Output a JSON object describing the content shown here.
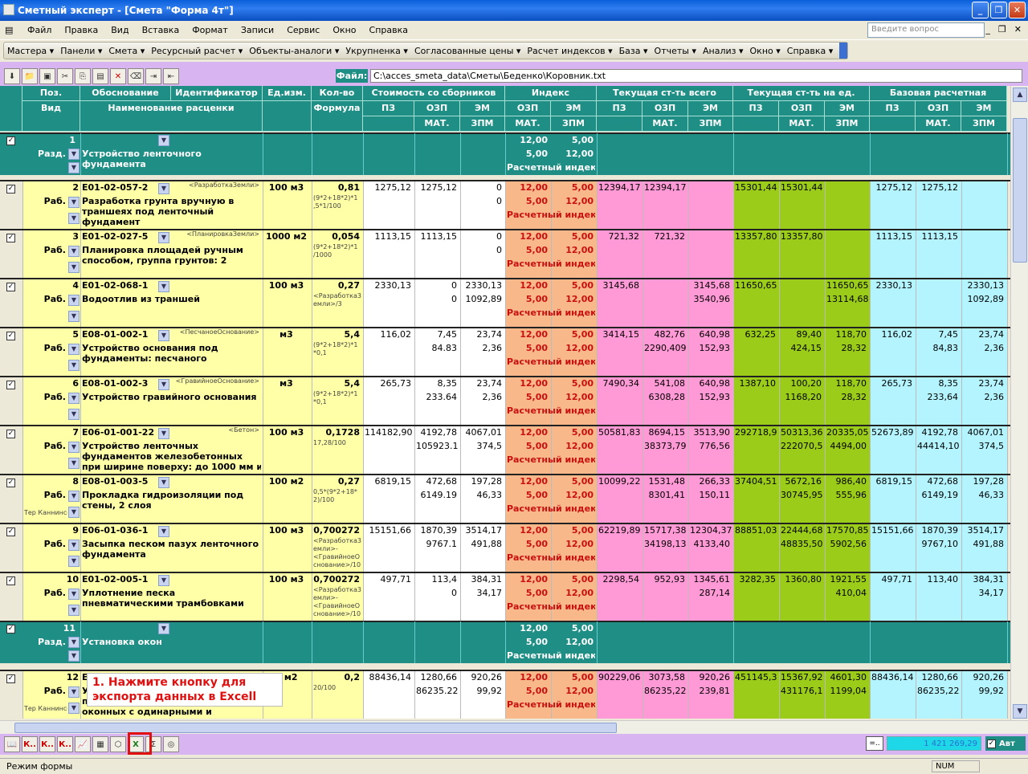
{
  "window": {
    "title": "Сметный эксперт - [Смета \"Форма 4т\"]"
  },
  "menu": [
    "Файл",
    "Правка",
    "Вид",
    "Вставка",
    "Формат",
    "Записи",
    "Сервис",
    "Окно",
    "Справка"
  ],
  "ask_placeholder": "Введите вопрос",
  "toolbar2": [
    "Мастера ▾",
    "Панели ▾",
    "Смета ▾",
    "Ресурсный расчет ▾",
    "Объекты-аналоги ▾",
    "Укрупненка ▾",
    "Согласованные цены ▾",
    "Расчет индексов ▾",
    "База ▾",
    "Отчеты ▾",
    "Анализ ▾",
    "Окно ▾",
    "Справка ▾"
  ],
  "file": {
    "label": "Файл:",
    "path": "C:\\acces_smeta_data\\Сметы\\Беденко\\Коровник.txt"
  },
  "headers": {
    "r1": [
      "Поз.",
      "Обоснование",
      "Идентификатор",
      "Ед.изм.",
      "Кол-во",
      "Стоимость со сборников",
      "Индекс",
      "Текущая ст-ть всего",
      "Текущая ст-ть на ед.",
      "Базовая расчетная"
    ],
    "vid": "Вид",
    "naim": "Наименование расценки",
    "formula": "Формула",
    "sub1": [
      "ПЗ",
      "ОЗП",
      "ЭМ",
      "ОЗП",
      "ЭМ",
      "ПЗ",
      "ОЗП",
      "ЭМ",
      "ПЗ",
      "ОЗП",
      "ЭМ",
      "ПЗ",
      "ОЗП",
      "ЭМ"
    ],
    "sub2": [
      "МАТ.",
      "ЗПМ",
      "МАТ.",
      "ЗПМ",
      "МАТ.",
      "ЗПМ",
      "МАТ.",
      "ЗПМ",
      "МАТ.",
      "ЗПМ"
    ]
  },
  "sections": [
    {
      "num": "1",
      "vid": "Разд.",
      "name1": "Устройство ленточного",
      "name2": "фундамента",
      "i1": "12,00",
      "i2": "5,00",
      "i3": "5,00",
      "i4": "12,00",
      "i5": "Расчетный индекс"
    },
    {
      "num": "11",
      "vid": "Разд.",
      "name1": "Установка окон",
      "name2": "",
      "i1": "12,00",
      "i2": "5,00",
      "i3": "5,00",
      "i4": "12,00",
      "i5": "Расчетный индекс"
    }
  ],
  "rows": [
    {
      "num": "2",
      "code": "Е01-02-057-2",
      "tag": "<РазработкаЗемли>",
      "unit": "100 м3",
      "qty": "0,81",
      "f1": "(9*2+18*2)*1",
      "f2": ",5*1/100",
      "f3": "",
      "vid": "Раб.",
      "n1": "Разработка грунта вручную в",
      "n2": "траншеях под ленточный",
      "n3": "фундамент",
      "pz": "1275,12",
      "ozp": "1275,12",
      "em": "0",
      "mat": "",
      "zpm": "0",
      "cpz": "12394,17",
      "cozp": "12394,17",
      "cem": "",
      "cmat": "",
      "czpm": "",
      "upz": "15301,44",
      "uozp": "15301,44",
      "uem": "",
      "umat": "",
      "uzpm": "",
      "bpz": "1275,12",
      "bozp": "1275,12",
      "bem": "",
      "bmat": "",
      "bzpm": "",
      "extra": ""
    },
    {
      "num": "3",
      "code": "Е01-02-027-5",
      "tag": "<ПланировкаЗемли>",
      "unit": "1000 м2",
      "qty": "0,054",
      "f1": "(9*2+18*2)*1",
      "f2": "/1000",
      "f3": "",
      "vid": "Раб.",
      "n1": "Планировка площадей ручным",
      "n2": "способом, группа грунтов: 2",
      "n3": "",
      "pz": "1113,15",
      "ozp": "1113,15",
      "em": "0",
      "mat": "",
      "zpm": "0",
      "cpz": "721,32",
      "cozp": "721,32",
      "cem": "",
      "cmat": "",
      "czpm": "",
      "upz": "13357,80",
      "uozp": "13357,80",
      "uem": "",
      "umat": "",
      "uzpm": "",
      "bpz": "1113,15",
      "bozp": "1113,15",
      "bem": "",
      "bmat": "",
      "bzpm": "",
      "extra": ""
    },
    {
      "num": "4",
      "code": "Е01-02-068-1",
      "tag": "",
      "unit": "100 м3",
      "qty": "0,27",
      "f1": "<Разработка3",
      "f2": "емли>/3",
      "f3": "",
      "vid": "Раб.",
      "n1": "Водоотлив из траншей",
      "n2": "",
      "n3": "",
      "pz": "2330,13",
      "ozp": "0",
      "em": "2330,13",
      "mat": "0",
      "zpm": "1092,89",
      "cpz": "3145,68",
      "cozp": "",
      "cem": "3145,68",
      "cmat": "",
      "czpm": "3540,96",
      "upz": "11650,65",
      "uozp": "",
      "uem": "11650,65",
      "umat": "",
      "uzpm": "13114,68",
      "bpz": "2330,13",
      "bozp": "",
      "bem": "2330,13",
      "bmat": "",
      "bzpm": "1092,89",
      "extra": ""
    },
    {
      "num": "5",
      "code": "Е08-01-002-1",
      "tag": "<ПесчаноеОснование>",
      "unit": "м3",
      "qty": "5,4",
      "f1": "(9*2+18*2)*1",
      "f2": "*0,1",
      "f3": "",
      "vid": "Раб.",
      "n1": "Устройство основания под",
      "n2": "фундаменты: песчаного",
      "n3": "",
      "pz": "116,02",
      "ozp": "7,45",
      "em": "23,74",
      "mat": "84.83",
      "zpm": "2,36",
      "cpz": "3414,15",
      "cozp": "482,76",
      "cem": "640,98",
      "cmat": "2290,4099",
      "czpm": "152,93",
      "upz": "632,25",
      "uozp": "89,40",
      "uem": "118,70",
      "umat": "424,15",
      "uzpm": "28,32",
      "bpz": "116,02",
      "bozp": "7,45",
      "bem": "23,74",
      "bmat": "84,83",
      "bzpm": "2,36",
      "extra": ""
    },
    {
      "num": "6",
      "code": "Е08-01-002-3",
      "tag": "<ГравийноеОснование>",
      "unit": "м3",
      "qty": "5,4",
      "f1": "(9*2+18*2)*1",
      "f2": "*0,1",
      "f3": "",
      "vid": "Раб.",
      "n1": "Устройство гравийного основания",
      "n2": "",
      "n3": "",
      "pz": "265,73",
      "ozp": "8,35",
      "em": "23,74",
      "mat": "233.64",
      "zpm": "2,36",
      "cpz": "7490,34",
      "cozp": "541,08",
      "cem": "640,98",
      "cmat": "6308,28",
      "czpm": "152,93",
      "upz": "1387,10",
      "uozp": "100,20",
      "uem": "118,70",
      "umat": "1168,20",
      "uzpm": "28,32",
      "bpz": "265,73",
      "bozp": "8,35",
      "bem": "23,74",
      "bmat": "233,64",
      "bzpm": "2,36",
      "extra": ""
    },
    {
      "num": "7",
      "code": "Е06-01-001-22",
      "tag": "<Бетон>",
      "unit": "100 м3",
      "qty": "0,1728",
      "f1": "17,28/100",
      "f2": "",
      "f3": "",
      "vid": "Раб.",
      "n1": "Устройство ленточных",
      "n2": "фундаментов железобетонных",
      "n3": "при ширине поверху: до 1000 мм из",
      "pz": "114182,90",
      "ozp": "4192,78",
      "em": "4067,01",
      "mat": "105923.1",
      "zpm": "374,5",
      "cpz": "50581,83",
      "cozp": "8694,15",
      "cem": "3513,90",
      "cmat": "38373,79",
      "czpm": "776,56",
      "upz": "292718,90",
      "uozp": "50313,36",
      "uem": "20335,05",
      "umat": "222070,50",
      "uzpm": "4494,00",
      "bpz": "52673,89",
      "bozp": "4192,78",
      "bem": "4067,01",
      "bmat": "44414,10",
      "bzpm": "374,5",
      "extra": ""
    },
    {
      "num": "8",
      "code": "Е08-01-003-5",
      "tag": "",
      "unit": "100 м2",
      "qty": "0,27",
      "f1": "0,5*(9*2+18*",
      "f2": "2)/100",
      "f3": "",
      "vid": "Раб.",
      "n1": "Прокладка гидроизоляции под",
      "n2": "стены, 2 слоя",
      "n3": "",
      "pz": "6819,15",
      "ozp": "472,68",
      "em": "197,28",
      "mat": "6149.19",
      "zpm": "46,33",
      "cpz": "10099,22",
      "cozp": "1531,48",
      "cem": "266,33",
      "cmat": "8301,41",
      "czpm": "150,11",
      "upz": "37404,51",
      "uozp": "5672,16",
      "uem": "986,40",
      "umat": "30745,95",
      "uzpm": "555,96",
      "bpz": "6819,15",
      "bozp": "472,68",
      "bem": "197,28",
      "bmat": "6149,19",
      "bzpm": "46,33",
      "extra": "Тер Каннинсер"
    },
    {
      "num": "9",
      "code": "Е06-01-036-1",
      "tag": "",
      "unit": "100 м3",
      "qty": "0,700272",
      "f1": "<Разработка3",
      "f2": "емли>-",
      "f3": "<ГравийноеО",
      "f4": "снование>/10",
      "vid": "Раб.",
      "n1": "Засыпка песком пазух ленточного",
      "n2": "фундамента",
      "n3": "",
      "pz": "15151,66",
      "ozp": "1870,39",
      "em": "3514,17",
      "mat": "9767.1",
      "zpm": "491,88",
      "cpz": "62219,89",
      "cozp": "15717,38",
      "cem": "12304,37",
      "cmat": "34198,13",
      "czpm": "4133,40",
      "upz": "88851,03",
      "uozp": "22444,68",
      "uem": "17570,85",
      "umat": "48835,50",
      "uzpm": "5902,56",
      "bpz": "15151,66",
      "bozp": "1870,39",
      "bem": "3514,17",
      "bmat": "9767,10",
      "bzpm": "491,88",
      "extra": ""
    },
    {
      "num": "10",
      "code": "Е01-02-005-1",
      "tag": "",
      "unit": "100 м3",
      "qty": "0,700272",
      "f1": "<Разработка3",
      "f2": "емли>-",
      "f3": "<ГравийноеО",
      "f4": "снование>/10",
      "vid": "Раб.",
      "n1": "Уплотнение песка",
      "n2": "пневматическими трамбовками",
      "n3": "",
      "pz": "497,71",
      "ozp": "113,4",
      "em": "384,31",
      "mat": "0",
      "zpm": "34,17",
      "cpz": "2298,54",
      "cozp": "952,93",
      "cem": "1345,61",
      "cmat": "",
      "czpm": "287,14",
      "upz": "3282,35",
      "uozp": "1360,80",
      "uem": "1921,55",
      "umat": "",
      "uzpm": "410,04",
      "bpz": "497,71",
      "bozp": "113,40",
      "bem": "384,31",
      "bmat": "",
      "bzpm": "34,17",
      "extra": ""
    },
    {
      "num": "12",
      "code": "Е1",
      "tag": "",
      "unit": "0 м2",
      "qty": "0,2",
      "f1": "20/100",
      "f2": "",
      "f3": "",
      "vid": "Раб.",
      "n1": "Ус",
      "n2": "пр",
      "n3": "оконных с одинарными и",
      "pz": "88436,14",
      "ozp": "1280,66",
      "em": "920,26",
      "mat": "86235.22",
      "zpm": "99,92",
      "cpz": "90229,06",
      "cozp": "3073,58",
      "cem": "920,26",
      "cmat": "86235,22",
      "czpm": "239,81",
      "upz": "451145,30",
      "uozp": "15367,92",
      "uem": "4601,30",
      "umat": "431176,10",
      "uzpm": "1199,04",
      "bpz": "88436,14",
      "bozp": "1280,66",
      "bem": "920,26",
      "bmat": "86235,22",
      "bzpm": "99,92",
      "extra": "Тер Каннинсер"
    }
  ],
  "index": {
    "a": "12,00",
    "b": "5,00",
    "c": "5,00",
    "d": "12,00",
    "e": "Расчетный индекс"
  },
  "callout": {
    "line1": "1. Нажмите кнопку для",
    "line2": "экспорта данных в Excell"
  },
  "bottom": {
    "total": "1 421 269,29",
    "avt": "Авт",
    "buttons": [
      "К..",
      "К..",
      "К.."
    ]
  },
  "status": {
    "mode": "Режим формы",
    "num": "NUM"
  },
  "colors": {
    "teal": "#1f8f86",
    "yellow": "#ffffa8",
    "pink": "#ff9ad6",
    "green": "#9ccc1a",
    "cyan": "#b4f4ff",
    "salmon": "#f8b88a",
    "indexRed": "#c81010"
  }
}
